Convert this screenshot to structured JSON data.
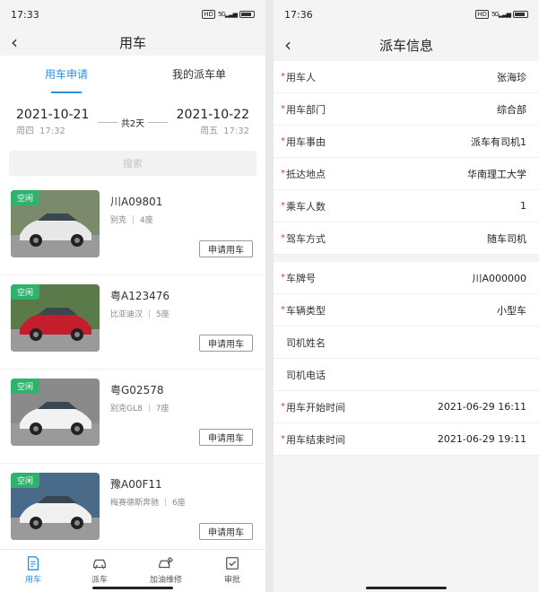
{
  "left": {
    "status_time": "17:33",
    "status_icons": {
      "hd": "HD",
      "net": "5G"
    },
    "title": "用车",
    "tabs": [
      {
        "label": "用车申请",
        "active": true
      },
      {
        "label": "我的派车单",
        "active": false
      }
    ],
    "start": {
      "date": "2021-10-21",
      "weekday": "周四",
      "time": "17:32"
    },
    "end": {
      "date": "2021-10-22",
      "weekday": "周五",
      "time": "17:32"
    },
    "duration": "共2天",
    "search_placeholder": "搜索",
    "cars": [
      {
        "tag": "空闲",
        "plate": "川A09801",
        "brand": "别克",
        "seats": "4座",
        "button": "申请用车",
        "body_color": "#e8e8e8",
        "bg": "#7a8a6a"
      },
      {
        "tag": "空闲",
        "plate": "粤A123476",
        "brand": "比亚迪汉",
        "seats": "5座",
        "button": "申请用车",
        "body_color": "#c41d2b",
        "bg": "#5a7a4a"
      },
      {
        "tag": "空闲",
        "plate": "粤G02578",
        "brand": "别克GL8",
        "seats": "7座",
        "button": "申请用车",
        "body_color": "#f2f2f2",
        "bg": "#8a8a8a"
      },
      {
        "tag": "空闲",
        "plate": "豫A00F11",
        "brand": "梅赛德斯奔驰",
        "seats": "6座",
        "button": "申请用车",
        "body_color": "#f0f0f0",
        "bg": "#4a6a8a"
      }
    ],
    "nav": [
      {
        "label": "用车",
        "icon": "document-edit-icon",
        "active": true
      },
      {
        "label": "派车",
        "icon": "car-icon",
        "active": false
      },
      {
        "label": "加油维修",
        "icon": "car-repair-icon",
        "active": false
      },
      {
        "label": "审批",
        "icon": "checkbox-icon",
        "active": false
      }
    ],
    "accent": "#2c8fe2",
    "free_tag_color": "#2fb26b"
  },
  "right": {
    "status_time": "17:36",
    "title": "派车信息",
    "group1": [
      {
        "label": "用车人",
        "value": "张海珍",
        "required": true
      },
      {
        "label": "用车部门",
        "value": "综合部",
        "required": true
      },
      {
        "label": "用车事由",
        "value": "派车有司机1",
        "required": true
      },
      {
        "label": "抵达地点",
        "value": "华南理工大学",
        "required": true
      },
      {
        "label": "乘车人数",
        "value": "1",
        "required": true
      },
      {
        "label": "驾车方式",
        "value": "随车司机",
        "required": true
      }
    ],
    "group2": [
      {
        "label": "车牌号",
        "value": "川A000000",
        "required": true
      },
      {
        "label": "车辆类型",
        "value": "小型车",
        "required": true
      },
      {
        "label": "司机姓名",
        "value": "",
        "required": false
      },
      {
        "label": "司机电话",
        "value": "",
        "required": false
      },
      {
        "label": "用车开始时间",
        "value": "2021-06-29 16:11",
        "required": true
      },
      {
        "label": "用车结束时间",
        "value": "2021-06-29 19:11",
        "required": true
      }
    ],
    "required_mark": "*"
  }
}
